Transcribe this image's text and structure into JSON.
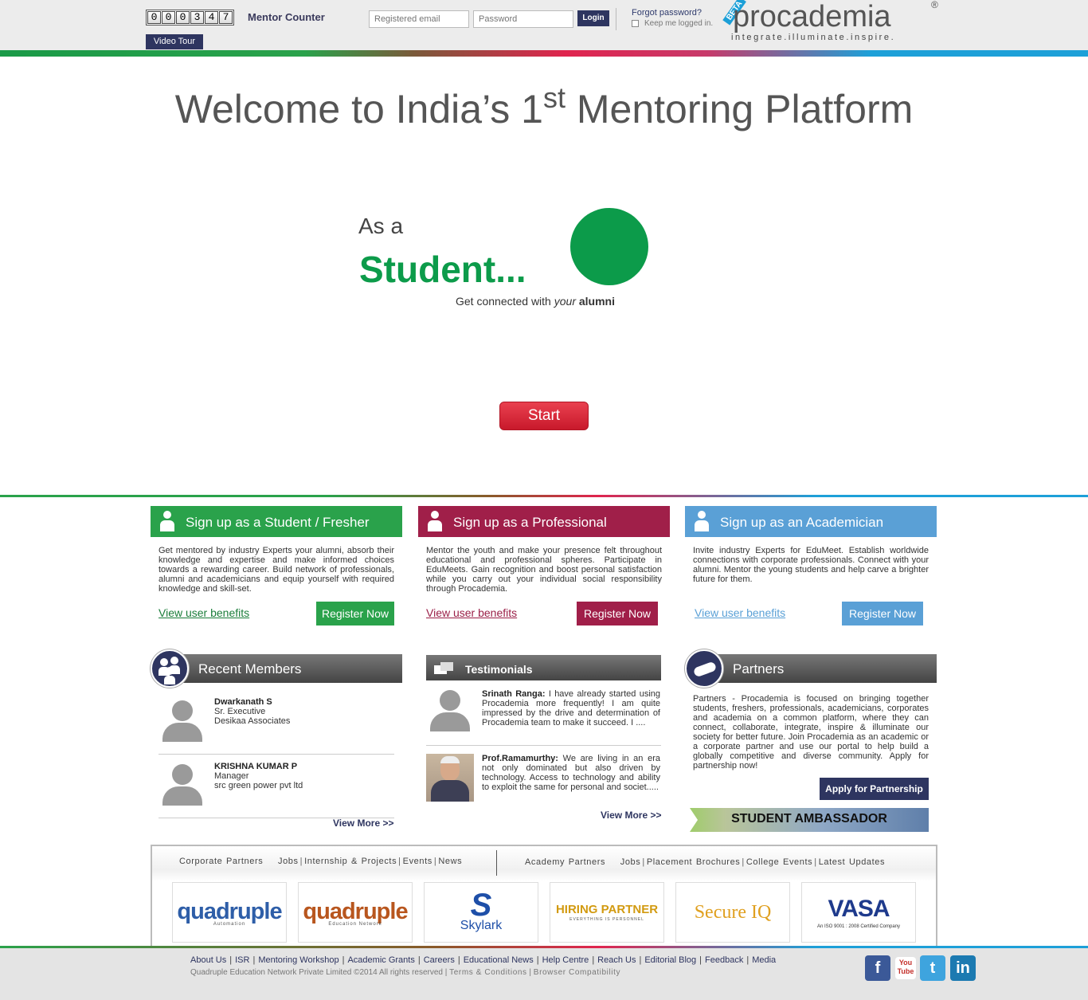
{
  "header": {
    "counter_digits": [
      "0",
      "0",
      "0",
      "3",
      "4",
      "7"
    ],
    "counter_label": "Mentor Counter",
    "video_tour": "Video Tour",
    "email_placeholder": "Registered email",
    "password_placeholder": "Password",
    "login": "Login",
    "forgot": "Forgot password?",
    "keep_logged": "Keep me logged in.",
    "logo_word": "procademia",
    "logo_tagline": "integrate.illuminate.inspire.",
    "logo_badge": "BETA",
    "logo_reg": "®"
  },
  "hero": {
    "welcome_pre": "Welcome to India’s 1",
    "welcome_sup": "st",
    "welcome_post": " Mentoring Platform",
    "as_a": "As a",
    "role": "Student...",
    "tagline_pre": "Get connected with ",
    "tagline_em": "your",
    "tagline_bold": " alumni",
    "start": "Start"
  },
  "cards": {
    "student": {
      "title": "Sign up as a Student / Fresher",
      "text": "Get mentored by industry Experts your alumni, absorb their knowledge and expertise and make informed choices towards a rewarding career. Build network of professionals, alumni and academicians and equip yourself with required knowledge and skill-set.",
      "link": "View user benefits",
      "button": "Register Now"
    },
    "professional": {
      "title": "Sign up as a Professional",
      "text": "Mentor the youth and make your presence felt throughout educational and professional spheres. Participate in EduMeets. Gain recognition and boost personal satisfaction while you carry out your individual social responsibility through Procademia.",
      "link": "View user benefits",
      "button": "Register Now"
    },
    "academician": {
      "title": "Sign up as an Academician",
      "text": "Invite industry Experts for EduMeet. Establish worldwide connections with corporate professionals. Connect with your alumni. Mentor the young students and help carve a brighter future for them.",
      "link": "View user benefits",
      "button": "Register Now"
    }
  },
  "recent": {
    "title": "Recent Members",
    "members": [
      {
        "name": "Dwarkanath S",
        "role": "Sr. Executive",
        "org": "Desikaa Associates"
      },
      {
        "name": "KRISHNA KUMAR P",
        "role": "Manager",
        "org": "src green power pvt ltd"
      }
    ],
    "view_more": "View More >>"
  },
  "testimonials": {
    "title": "Testimonials",
    "items": [
      {
        "name": "Srinath Ranga:",
        "text": " I have already started using Procademia more frequently! I am quite impressed by the drive and determination of Procademia team to make it succeed. I ...."
      },
      {
        "name": "Prof.Ramamurthy:",
        "text": " We are living in an era not only dominated but also driven by technology. Access to technology and ability to exploit the same for personal and societ....."
      }
    ],
    "view_more": "View More >>"
  },
  "partners": {
    "title": "Partners",
    "text": "Partners - Procademia is focused on bringing together students, freshers, professionals, academicians, corporates and academia on a common platform, where they can connect, collaborate, integrate, inspire & illuminate our society for better future. Join Procademia as an academic or a corporate partner and use our portal to help build a globally competitive and diverse community. Apply for partnership now!",
    "apply": "Apply for Partnership",
    "ambassador": "STUDENT AMBASSADOR"
  },
  "partner_box": {
    "corporate": "Corporate Partners",
    "corp_links": [
      "Jobs",
      "Internship & Projects",
      "Events",
      "News"
    ],
    "academy": "Academy Partners",
    "acad_links": [
      "Jobs",
      "Placement Brochures",
      "College Events",
      "Latest Updates"
    ],
    "logos": [
      {
        "main": "quadruple",
        "sub": "Automation",
        "color": "#2e5ea8"
      },
      {
        "main": "quadruple",
        "sub": "Education Network",
        "color": "#b8561e"
      },
      {
        "main": "Skylark",
        "sub": "",
        "color": "#1e4fa8"
      },
      {
        "main": "HIRING PARTNER",
        "sub": "EVERYTHING IS PERSONNEL",
        "color": "#d29a10"
      },
      {
        "main": "Secure IQ",
        "sub": "",
        "color": "#e0a020"
      },
      {
        "main": "VASA",
        "sub": "An ISO 9001 : 2008 Certified Company",
        "color": "#1e3a8c"
      }
    ]
  },
  "footer": {
    "links": [
      "About Us",
      "ISR",
      "Mentoring Workshop",
      "Academic Grants",
      "Careers",
      "Educational News",
      "Help Centre",
      "Reach Us",
      "Editorial Blog",
      "Feedback",
      "Media"
    ],
    "copyright": "Quadruple Education Network Private Limited ©2014 All rights reserved",
    "terms": "Terms & Conditions",
    "browser": "Browser Compatibility",
    "social": [
      "facebook-icon",
      "youtube-icon",
      "twitter-icon",
      "linkedin-icon"
    ],
    "youtube_label": "You Tube"
  }
}
